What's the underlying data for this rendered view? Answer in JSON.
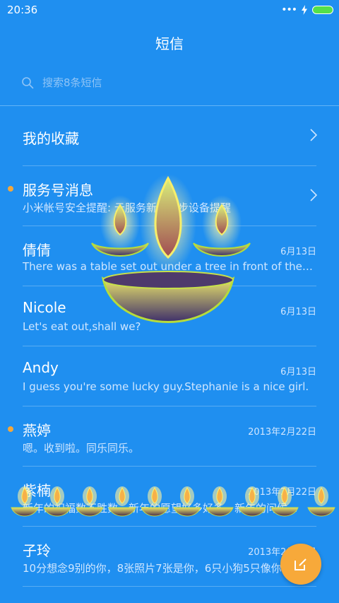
{
  "status": {
    "time": "20:36",
    "dots": "•••"
  },
  "header": {
    "title": "短信"
  },
  "search": {
    "placeholder": "搜索8条短信"
  },
  "conversations": [
    {
      "name": "我的收藏",
      "preview": "",
      "date": "",
      "unread": false,
      "chevron": true
    },
    {
      "name": "服务号消息",
      "preview": "小米帐号安全提醒: 云服务新增同步设备提醒",
      "date": "",
      "unread": true,
      "chevron": true
    },
    {
      "name": "倩倩",
      "preview": "There was a table set out under a tree in front of the ho...",
      "date": "6月13日",
      "unread": false,
      "chevron": false
    },
    {
      "name": "Nicole",
      "preview": "Let's eat out,shall we?",
      "date": "6月13日",
      "unread": false,
      "chevron": false
    },
    {
      "name": "Andy",
      "preview": "I guess you're some lucky guy.Stephanie is a nice girl.",
      "date": "6月13日",
      "unread": false,
      "chevron": false
    },
    {
      "name": "燕婷",
      "preview": "嗯。收到啦。同乐同乐。",
      "date": "2013年2月22日",
      "unread": true,
      "chevron": false
    },
    {
      "name": "紫楠",
      "preview": "新年的祝福数不胜数，新年的愿望好多好多，新年的问候...",
      "date": "2013年2月22日",
      "unread": false,
      "chevron": false
    },
    {
      "name": "子玲",
      "preview": "10分想念9别的你，8张照片7张是你，6只小狗5只像你...",
      "date": "2013年2月22日",
      "unread": false,
      "chevron": false
    }
  ],
  "icons": {
    "search": "search-icon",
    "compose": "compose-icon",
    "chevron": "chevron-right-icon",
    "lamp": "diya-lamp-icon"
  },
  "colors": {
    "background": "#1f8ff0",
    "accent": "#f7a93a",
    "unread": "#f3a73b",
    "battery": "#54e04a"
  }
}
